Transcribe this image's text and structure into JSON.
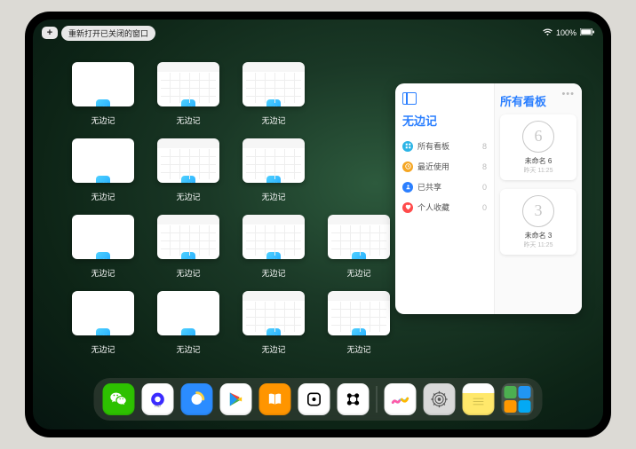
{
  "statusbar": {
    "battery_text": "100%"
  },
  "topbar": {
    "plus": "+",
    "reopen_label": "重新打开已关闭的窗口"
  },
  "app_name": "无边记",
  "sidebar": {
    "title": "无边记",
    "items": [
      {
        "icon": "grid",
        "color": "#2bb4e6",
        "label": "所有看板",
        "count": "8"
      },
      {
        "icon": "clock",
        "color": "#f5a623",
        "label": "最近使用",
        "count": "8"
      },
      {
        "icon": "people",
        "color": "#2b7fff",
        "label": "已共享",
        "count": "0"
      },
      {
        "icon": "heart",
        "color": "#ff4b4b",
        "label": "个人收藏",
        "count": "0"
      }
    ]
  },
  "boards": {
    "title": "所有看板",
    "items": [
      {
        "digit": "6",
        "name": "未命名 6",
        "date": "昨天 11:25"
      },
      {
        "digit": "3",
        "name": "未命名 3",
        "date": "昨天 11:25"
      }
    ]
  },
  "dock": {
    "apps": [
      {
        "name": "wechat",
        "bg": "#2dc100"
      },
      {
        "name": "quark",
        "bg": "#ffffff"
      },
      {
        "name": "qqbrowser",
        "bg": "#2b8cff"
      },
      {
        "name": "play",
        "bg": "#ffffff"
      },
      {
        "name": "books",
        "bg": "#ff9500"
      },
      {
        "name": "dice",
        "bg": "#ffffff"
      },
      {
        "name": "connect",
        "bg": "#ffffff"
      },
      {
        "name": "freeform",
        "bg": "#ffffff"
      },
      {
        "name": "settings",
        "bg": "#d9d9d9"
      },
      {
        "name": "notes",
        "bg": "#ffffff"
      }
    ]
  }
}
